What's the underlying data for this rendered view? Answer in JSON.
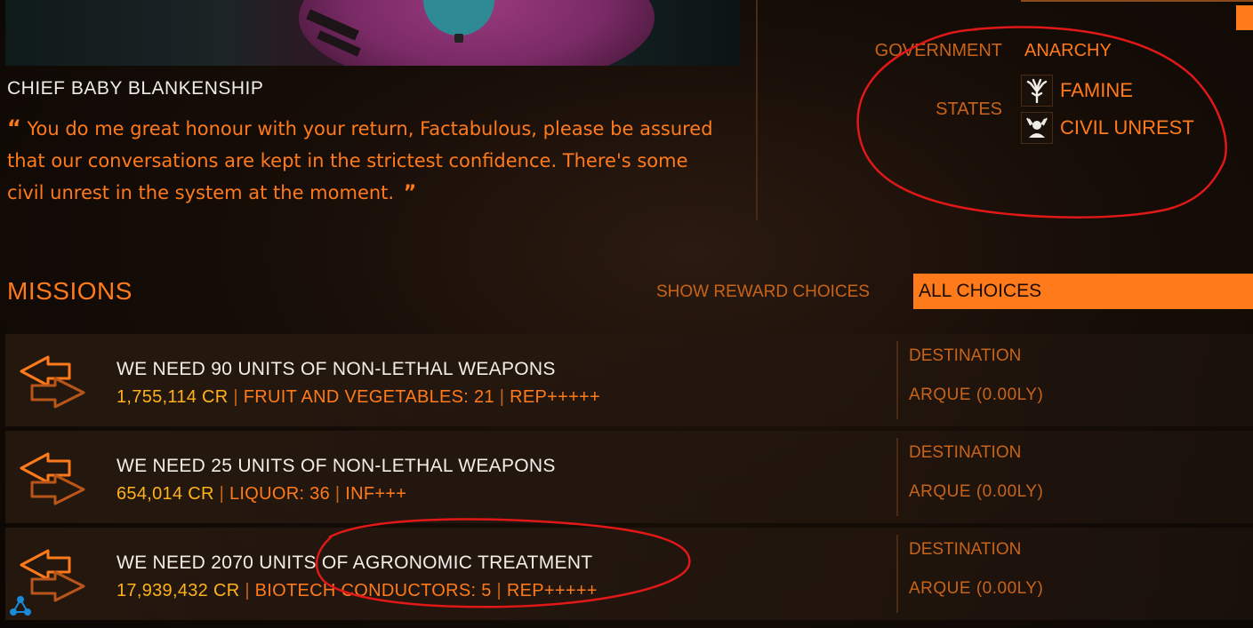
{
  "npc": {
    "name": "CHIEF BABY BLANKENSHIP",
    "quote_open": "“",
    "quote": "You do me great honour with your return, Factabulous, please be assured that our conversations are kept in the strictest confidence. There's some civil unrest in the system at the moment.",
    "quote_close": "”"
  },
  "faction": {
    "government_label": "GOVERNMENT",
    "government_value": "ANARCHY",
    "states_label": "STATES",
    "states": [
      {
        "label": "FAMINE",
        "icon": "famine-tree-icon"
      },
      {
        "label": "CIVIL UNREST",
        "icon": "civil-unrest-icon"
      }
    ]
  },
  "missions_panel": {
    "title": "MISSIONS",
    "reward_filter_label": "SHOW REWARD CHOICES",
    "reward_filter_value": "ALL CHOICES"
  },
  "missions": [
    {
      "title": "WE NEED 90 UNITS OF NON-LETHAL WEAPONS",
      "credits": "1,755,114 CR",
      "commodity": "FRUIT AND VEGETABLES: 21",
      "rep": "REP+++++",
      "destination_label": "DESTINATION",
      "destination": "ARQUE (0.00LY)"
    },
    {
      "title": "WE NEED 25 UNITS OF NON-LETHAL WEAPONS",
      "credits": "654,014 CR",
      "commodity": "LIQUOR: 36",
      "rep": "INF+++",
      "destination_label": "DESTINATION",
      "destination": "ARQUE (0.00LY)"
    },
    {
      "title": "WE NEED 2070 UNITS OF AGRONOMIC TREATMENT",
      "credits": "17,939,432 CR",
      "commodity": "BIOTECH CONDUCTORS: 5",
      "rep": "REP+++++",
      "destination_label": "DESTINATION",
      "destination": "ARQUE (0.00LY)"
    }
  ],
  "separator": "|",
  "colors": {
    "accent": "#ff7a1a",
    "label": "#c8641a",
    "credits": "#ffb21a",
    "annotation": "#e01818"
  }
}
